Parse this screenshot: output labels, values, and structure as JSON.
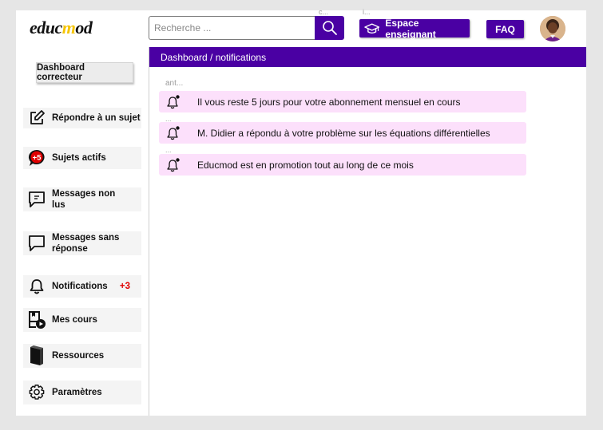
{
  "header": {
    "logo_parts": [
      "educ",
      "m",
      "od"
    ],
    "search_placeholder": "Recherche ...",
    "small_hint_1": "c...",
    "small_hint_2": "i...",
    "teacher_button": "Espace enseignant",
    "faq_button": "FAQ"
  },
  "sidebar": {
    "role_button": "Dashboard correcteur",
    "items": [
      {
        "label": "Répondre à  un sujet",
        "icon": "edit-icon"
      },
      {
        "label": "Sujets actifs",
        "icon": "chat-bubble-badge-icon",
        "icon_badge": "+5"
      },
      {
        "label": "Messages non lus",
        "icon": "message-icon"
      },
      {
        "label": "Messages sans réponse",
        "icon": "message-empty-icon"
      },
      {
        "label": "Notifications",
        "icon": "bell-icon",
        "badge": "+3"
      },
      {
        "label": "Mes cours",
        "icon": "course-play-icon"
      },
      {
        "label": "Ressources",
        "icon": "book-icon"
      },
      {
        "label": "Paramètres",
        "icon": "gear-icon"
      }
    ]
  },
  "main": {
    "breadcrumb": "Dashboard / notifications",
    "faint_label": "ant...",
    "notifications": [
      {
        "text": "Il vous reste 5 jours pour votre abonnement mensuel en cours"
      },
      {
        "text": "M. Didier a répondu à votre problème sur les équations différentielles"
      },
      {
        "text": "Educmod est en promotion  tout au long de ce mois"
      }
    ]
  },
  "colors": {
    "brand_purple": "#4a00a3",
    "logo_accent": "#f5c400",
    "notification_bg": "#fce0fb",
    "badge_red": "#e00000"
  }
}
